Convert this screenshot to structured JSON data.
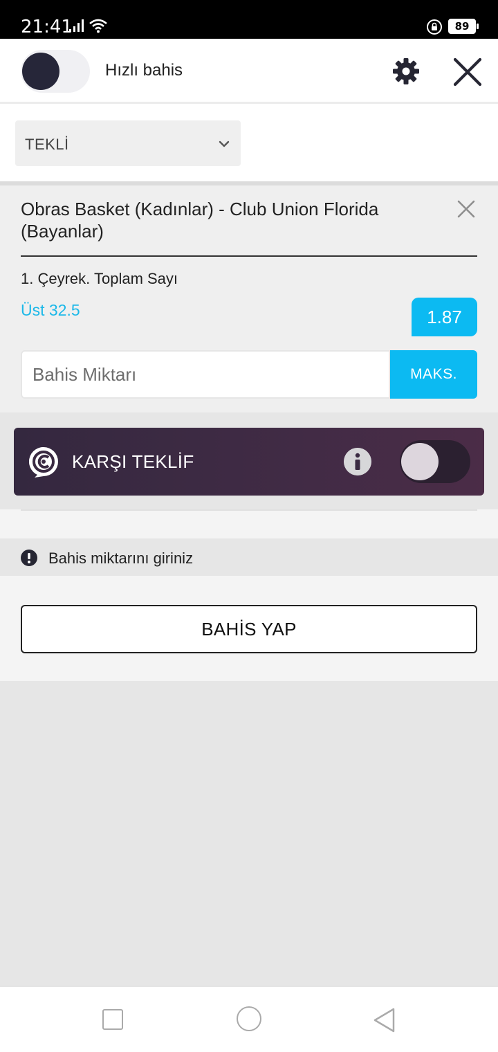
{
  "status_bar": {
    "time": "21:41",
    "battery": "89"
  },
  "header": {
    "quick_bet_label": "Hızlı bahis",
    "quick_bet_enabled": false
  },
  "bet_type": {
    "selected": "TEKLİ"
  },
  "bet": {
    "event": "Obras Basket (Kadınlar) - Club Union Florida (Bayanlar)",
    "market": "1. Çeyrek. Toplam Sayı",
    "selection": "Üst 32.5",
    "odds": "1.87",
    "stake_placeholder": "Bahis Miktarı",
    "max_label": "MAKS."
  },
  "counter_offer": {
    "label": "KARŞI TEKLİF",
    "enabled": false
  },
  "warning": {
    "text": "Bahis miktarını giriniz"
  },
  "place_bet": {
    "label": "BAHİS YAP"
  },
  "colors": {
    "accent": "#0cbaf2",
    "selection_text": "#1cb8e8",
    "banner_start": "#34283f",
    "banner_end": "#4b2c47"
  }
}
